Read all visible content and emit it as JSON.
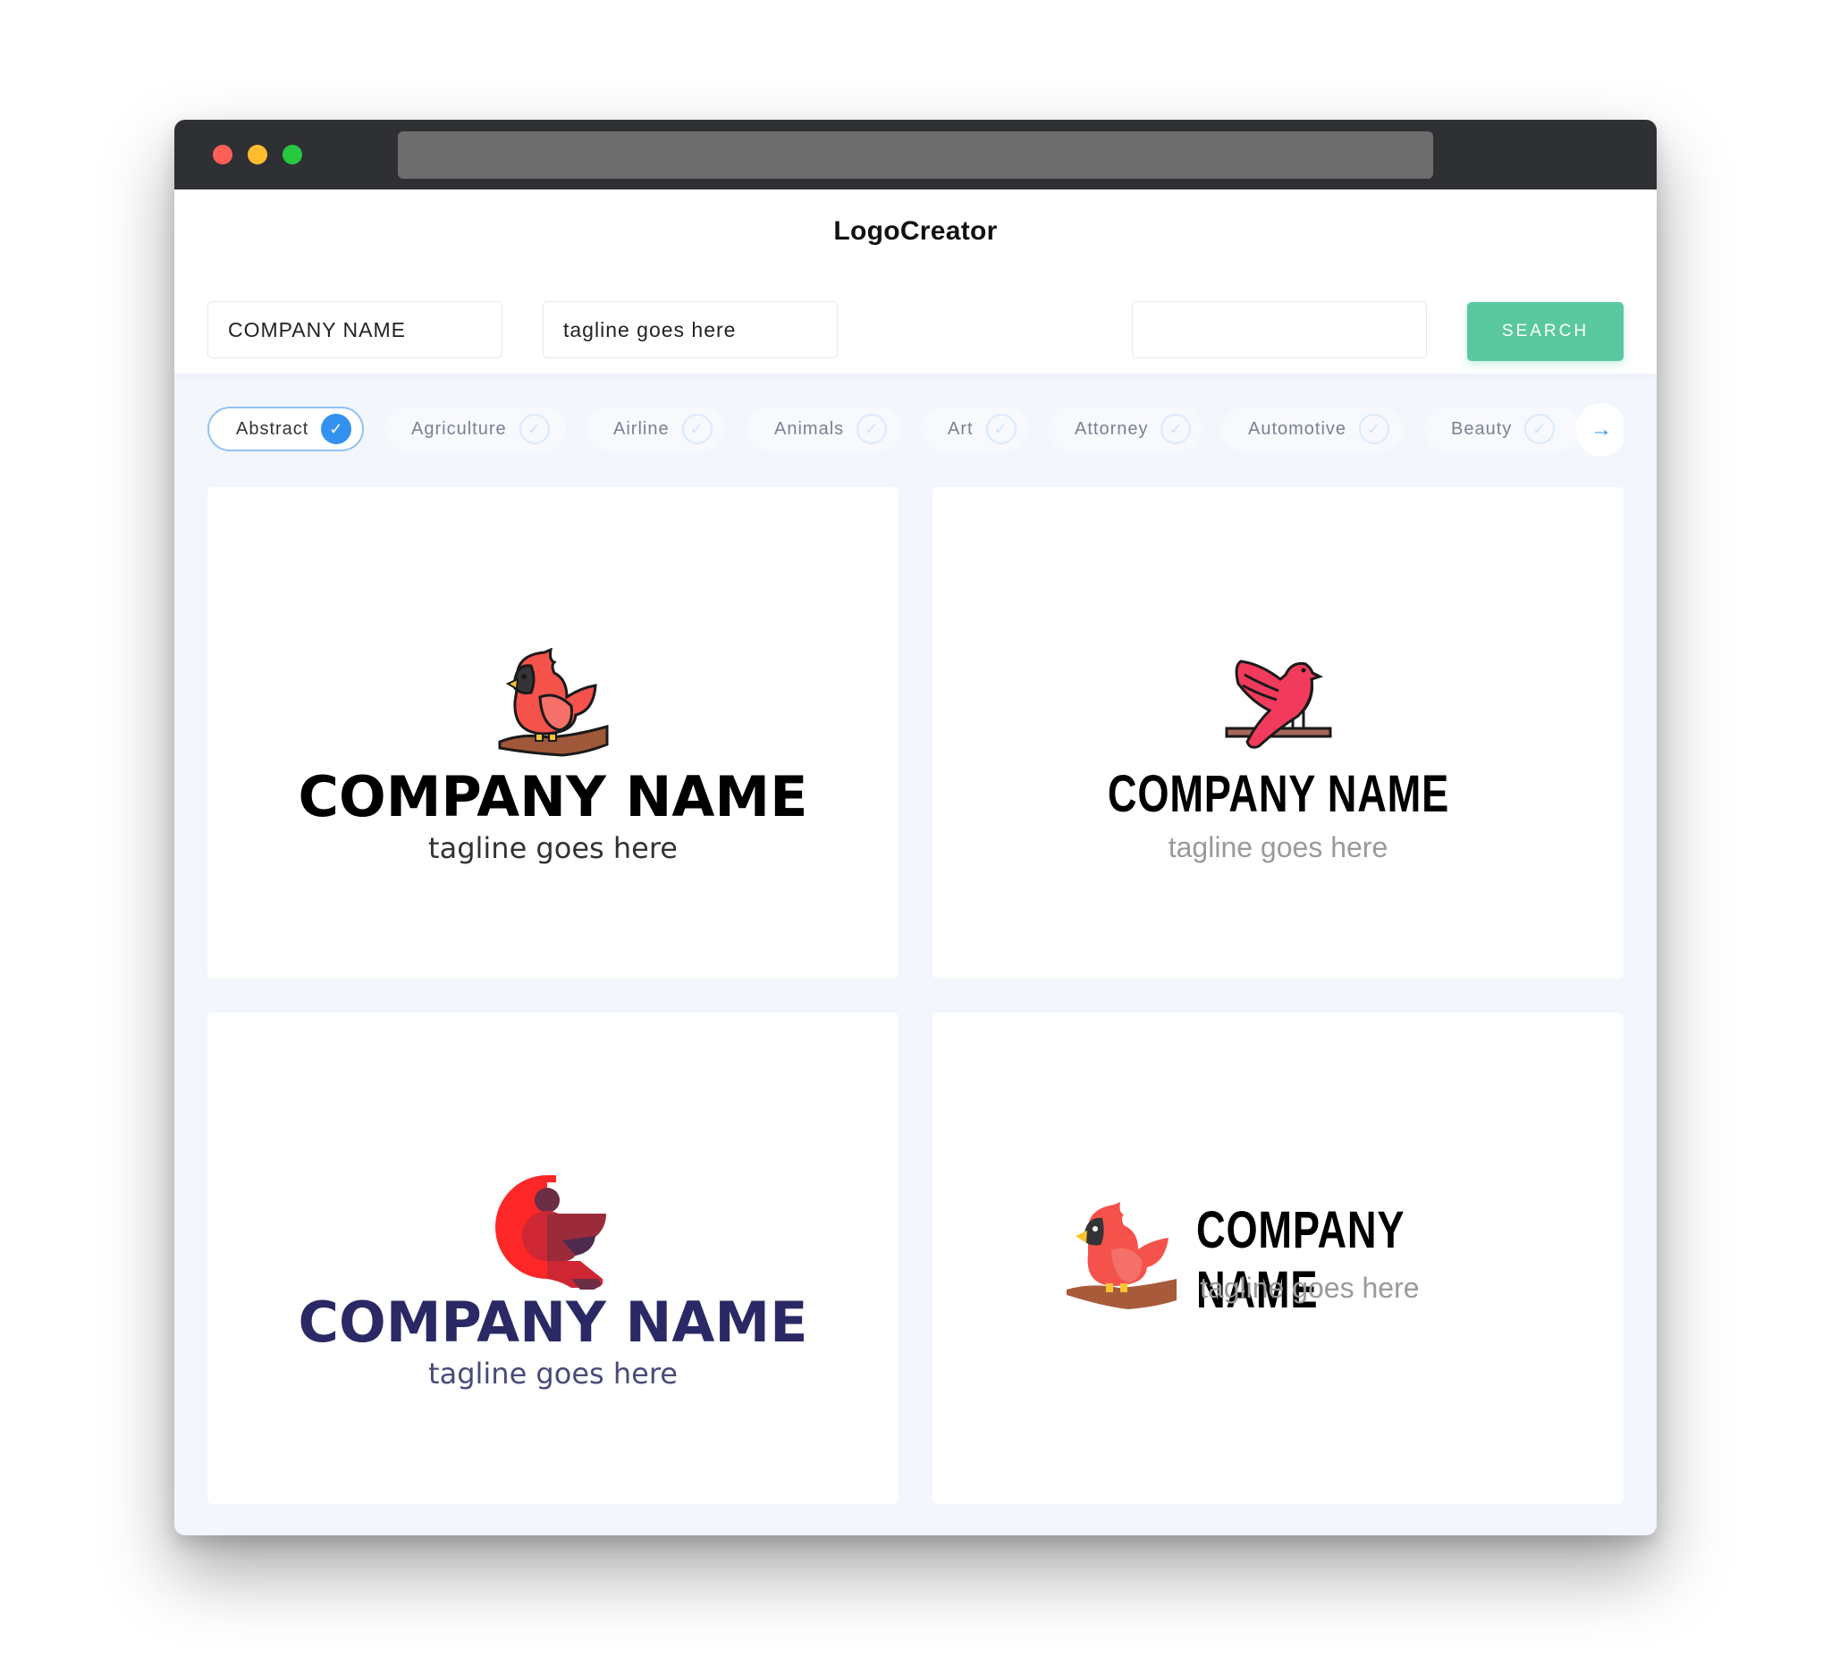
{
  "window": {
    "controls": [
      "close",
      "minimize",
      "maximize"
    ],
    "url": ""
  },
  "header": {
    "title": "LogoCreator"
  },
  "search": {
    "company_name": "COMPANY NAME",
    "tagline": "tagline goes here",
    "keyword": "",
    "button_label": "SEARCH"
  },
  "categories": {
    "items": [
      {
        "label": "Abstract",
        "selected": true
      },
      {
        "label": "Agriculture",
        "selected": false
      },
      {
        "label": "Airline",
        "selected": false
      },
      {
        "label": "Animals",
        "selected": false
      },
      {
        "label": "Art",
        "selected": false
      },
      {
        "label": "Attorney",
        "selected": false
      },
      {
        "label": "Automotive",
        "selected": false
      },
      {
        "label": "Beauty",
        "selected": false
      }
    ],
    "next_icon": "arrow-right-icon"
  },
  "logos": [
    {
      "company": "COMPANY NAME",
      "tagline": "tagline goes here",
      "icon": "cardinal-on-branch-outline-icon",
      "text_color": "#000000",
      "tagline_color": "#333333"
    },
    {
      "company": "COMPANY NAME",
      "tagline": "tagline goes here",
      "icon": "bird-on-perch-outline-icon",
      "text_color": "#000000",
      "tagline_color": "#9a9a9a"
    },
    {
      "company": "COMPANY NAME",
      "tagline": "tagline goes here",
      "icon": "geometric-cardinal-icon",
      "text_color": "#2a2966",
      "tagline_color": "#4a4a7a"
    },
    {
      "company": "COMPANY NAME",
      "tagline": "tagline goes here",
      "icon": "cardinal-on-branch-flat-icon",
      "text_color": "#000000",
      "tagline_color": "#9a9a9a"
    }
  ],
  "colors": {
    "accent": "#5ac89e",
    "selected": "#3391f0",
    "titlebar": "#2f3033",
    "page_bg": "#f3f6fd"
  }
}
